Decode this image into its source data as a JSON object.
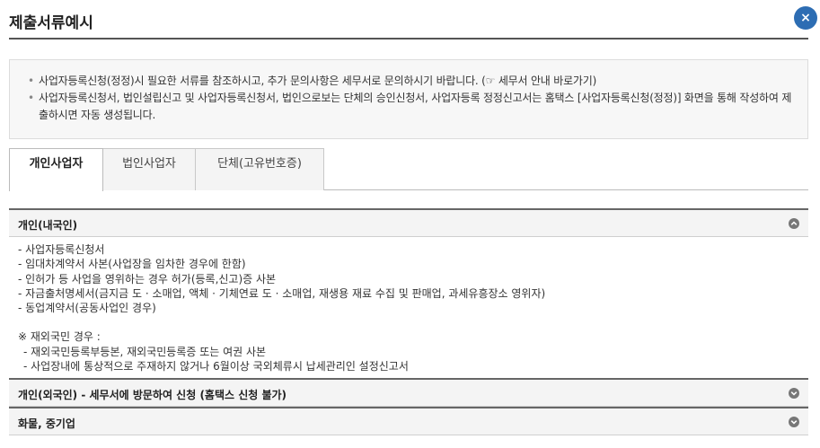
{
  "header": {
    "title": "제출서류예시",
    "close_label": "×"
  },
  "notice": {
    "items": [
      "사업자등록신청(정정)시 필요한 서류를 참조하시고, 추가 문의사항은 세무서로 문의하시기 바랍니다. (☞ 세무서 안내 바로가기)",
      "사업자등록신청서, 법인설립신고 및 사업자등록신청서, 법인으로보는 단체의 승인신청서, 사업자등록 정정신고서는 홈택스 [사업자등록신청(정정)] 화면을 통해 작성하여 제출하시면 자동 생성됩니다."
    ]
  },
  "tabs": [
    {
      "label": "개인사업자",
      "active": true
    },
    {
      "label": "법인사업자",
      "active": false
    },
    {
      "label": "단체(고유번호증)",
      "active": false
    }
  ],
  "accordion": [
    {
      "title": "개인(내국인)",
      "expanded": true,
      "lines": [
        "- 사업자등록신청서",
        "- 임대차계약서 사본(사업장을 임차한 경우에 한함)",
        "- 인허가 등 사업을 영위하는 경우 허가(등록,신고)증 사본",
        "- 자금출처명세서(금지금 도 · 소매업, 액체 · 기체연료 도 · 소매업, 재생용 재료 수집 및 판매업, 과세유흥장소 영위자)",
        "- 동업계약서(공동사업인 경우)"
      ],
      "note_title": "※ 재외국민 경우 :",
      "note_lines": [
        "- 재외국민등록부등본, 재외국민등록증 또는 여권 사본",
        "- 사업장내에 통상적으로 주재하지 않거나 6월이상 국외체류시 납세관리인 설정신고서"
      ]
    },
    {
      "title": "개인(외국인) - 세무서에 방문하여 신청 (홈택스 신청 불가)",
      "expanded": false
    },
    {
      "title": "화물, 중기업",
      "expanded": false
    }
  ]
}
